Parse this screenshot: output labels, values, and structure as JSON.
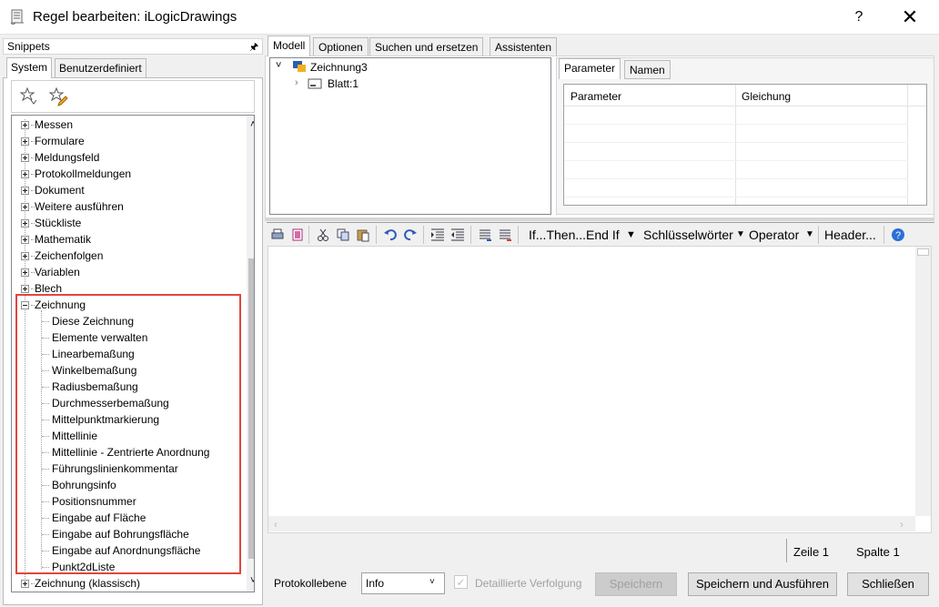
{
  "window": {
    "title": "Regel bearbeiten: iLogicDrawings",
    "help_label": "?",
    "close_label": "✕"
  },
  "snippets": {
    "title": "Snippets",
    "tabs": [
      "System",
      "Benutzerdefiniert"
    ],
    "categories": [
      "Messen",
      "Formulare",
      "Meldungsfeld",
      "Protokollmeldungen",
      "Dokument",
      "Weitere ausführen",
      "Stückliste",
      "Mathematik",
      "Zeichenfolgen",
      "Variablen",
      "Blech"
    ],
    "expanded": {
      "label": "Zeichnung",
      "children": [
        "Diese Zeichnung",
        "Elemente verwalten",
        "Linearbemaßung",
        "Winkelbemaßung",
        "Radiusbemaßung",
        "Durchmesserbemaßung",
        "Mittelpunktmarkierung",
        "Mittellinie",
        "Mittellinie - Zentrierte Anordnung",
        "Führungslinienkommentar",
        "Bohrungsinfo",
        "Positionsnummer",
        "Eingabe auf Fläche",
        "Eingabe auf Bohrungsfläche",
        "Eingabe auf Anordnungsfläche",
        "Punkt2dListe"
      ]
    },
    "last_category": "Zeichnung (klassisch)"
  },
  "main_tabs": [
    "Modell",
    "Optionen",
    "Suchen und ersetzen",
    "Assistenten"
  ],
  "model_tree": {
    "root": "Zeichnung3",
    "child": "Blatt:1"
  },
  "param_tabs": [
    "Parameter",
    "Namen"
  ],
  "param_grid": {
    "columns": [
      "Parameter",
      "Gleichung"
    ]
  },
  "toolbar": {
    "if_then": "If...Then...End If",
    "keywords": "Schlüsselwörter",
    "operator": "Operator",
    "header": "Header...",
    "dropdown_arrow": "▾"
  },
  "status": {
    "line": "Zeile 1",
    "column": "Spalte 1"
  },
  "bottom": {
    "log_level_label": "Protokollebene",
    "log_level_value": "Info",
    "detailed_trace": "Detaillierte Verfolgung",
    "save": "Speichern",
    "save_run": "Speichern und Ausführen",
    "close": "Schließen"
  }
}
